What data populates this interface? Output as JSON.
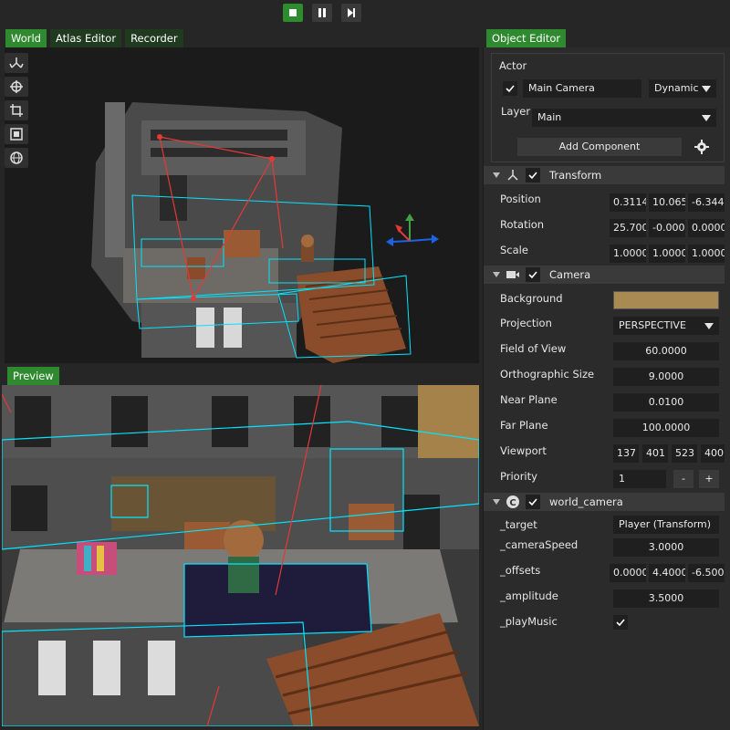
{
  "playbar": {
    "stop_icon": "stop-icon",
    "pause_icon": "pause-icon",
    "step_icon": "step-icon"
  },
  "left_tabs": [
    {
      "label": "World"
    },
    {
      "label": "Atlas Editor"
    },
    {
      "label": "Recorder"
    }
  ],
  "world_tools": [
    "move-tool-icon",
    "rotate-tool-icon",
    "crop-tool-icon",
    "scale-tool-icon",
    "globe-icon"
  ],
  "preview_tab": {
    "label": "Preview"
  },
  "right_tab": {
    "label": "Object Editor"
  },
  "actor": {
    "section_label": "Actor",
    "enabled": true,
    "name": "Main Camera",
    "mode": "Dynamic",
    "layer_label": "Layer",
    "layer": "Main",
    "add_component_label": "Add Component"
  },
  "transform": {
    "title": "Transform",
    "position_label": "Position",
    "position": [
      "0.3114",
      "10.065",
      "-6.3441"
    ],
    "rotation_label": "Rotation",
    "rotation": [
      "25.700",
      "-0.0000",
      "0.0000"
    ],
    "scale_label": "Scale",
    "scale": [
      "1.0000",
      "1.0000",
      "1.0000"
    ]
  },
  "camera": {
    "title": "Camera",
    "background_label": "Background",
    "background_color": "#A88A52",
    "projection_label": "Projection",
    "projection": "PERSPECTIVE",
    "fov_label": "Field of View",
    "fov": "60.0000",
    "ortho_label": "Orthographic Size",
    "ortho": "9.0000",
    "near_label": "Near Plane",
    "near": "0.0100",
    "far_label": "Far Plane",
    "far": "100.0000",
    "viewport_label": "Viewport",
    "viewport": [
      "137",
      "401",
      "523",
      "400"
    ],
    "priority_label": "Priority",
    "priority": "1",
    "minus": "-",
    "plus": "+"
  },
  "script": {
    "title": "world_camera",
    "target_label": "_target",
    "target": "Player (Transform)",
    "speed_label": "_cameraSpeed",
    "speed": "3.0000",
    "offsets_label": "_offsets",
    "offsets": [
      "0.0000",
      "4.4000",
      "-6.5000"
    ],
    "amplitude_label": "_amplitude",
    "amplitude": "3.5000",
    "music_label": "_playMusic",
    "music": true
  },
  "colors": {
    "accent": "#2F8A2F",
    "selection": "#00E5FF",
    "gizmo_x": "#E53935",
    "gizmo_y": "#43A047",
    "gizmo_z": "#1E63E6"
  }
}
